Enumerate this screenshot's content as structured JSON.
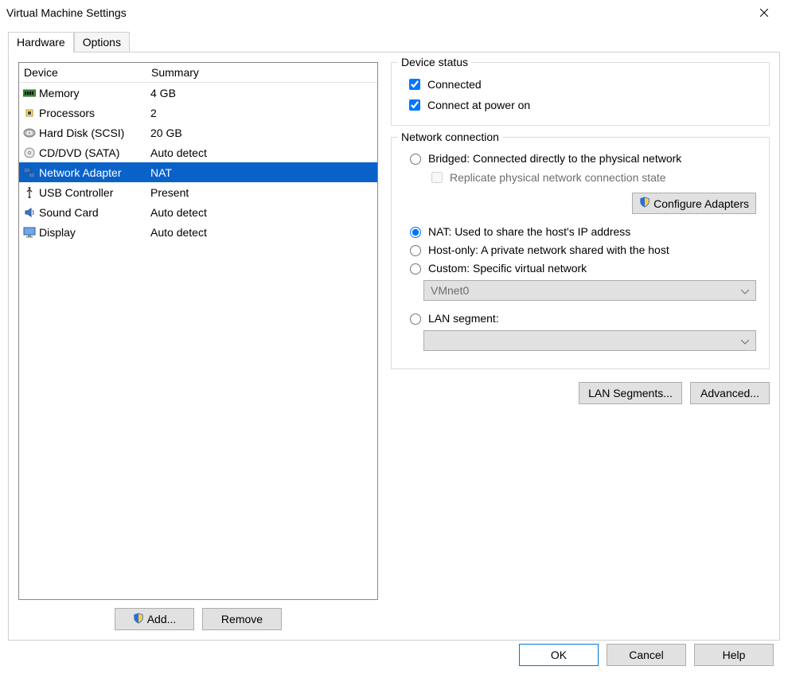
{
  "window": {
    "title": "Virtual Machine Settings"
  },
  "tabs": {
    "hardware": "Hardware",
    "options": "Options"
  },
  "listHeader": {
    "device": "Device",
    "summary": "Summary"
  },
  "devices": [
    {
      "name": "Memory",
      "summary": "4 GB",
      "icon": "memory"
    },
    {
      "name": "Processors",
      "summary": "2",
      "icon": "cpu"
    },
    {
      "name": "Hard Disk (SCSI)",
      "summary": "20 GB",
      "icon": "disk"
    },
    {
      "name": "CD/DVD (SATA)",
      "summary": "Auto detect",
      "icon": "cd"
    },
    {
      "name": "Network Adapter",
      "summary": "NAT",
      "icon": "network",
      "selected": true
    },
    {
      "name": "USB Controller",
      "summary": "Present",
      "icon": "usb"
    },
    {
      "name": "Sound Card",
      "summary": "Auto detect",
      "icon": "sound"
    },
    {
      "name": "Display",
      "summary": "Auto detect",
      "icon": "display"
    }
  ],
  "leftButtons": {
    "add": "Add...",
    "remove": "Remove"
  },
  "deviceStatus": {
    "groupTitle": "Device status",
    "connected": "Connected",
    "connectAtPowerOn": "Connect at power on"
  },
  "networkConnection": {
    "groupTitle": "Network connection",
    "bridged": "Bridged: Connected directly to the physical network",
    "replicate": "Replicate physical network connection state",
    "configureAdapters": "Configure Adapters",
    "nat": "NAT: Used to share the host's IP address",
    "hostOnly": "Host-only: A private network shared with the host",
    "custom": "Custom: Specific virtual network",
    "customSelected": "VMnet0",
    "lanSegment": "LAN segment:"
  },
  "rightButtons": {
    "lanSegments": "LAN Segments...",
    "advanced": "Advanced..."
  },
  "footer": {
    "ok": "OK",
    "cancel": "Cancel",
    "help": "Help"
  }
}
